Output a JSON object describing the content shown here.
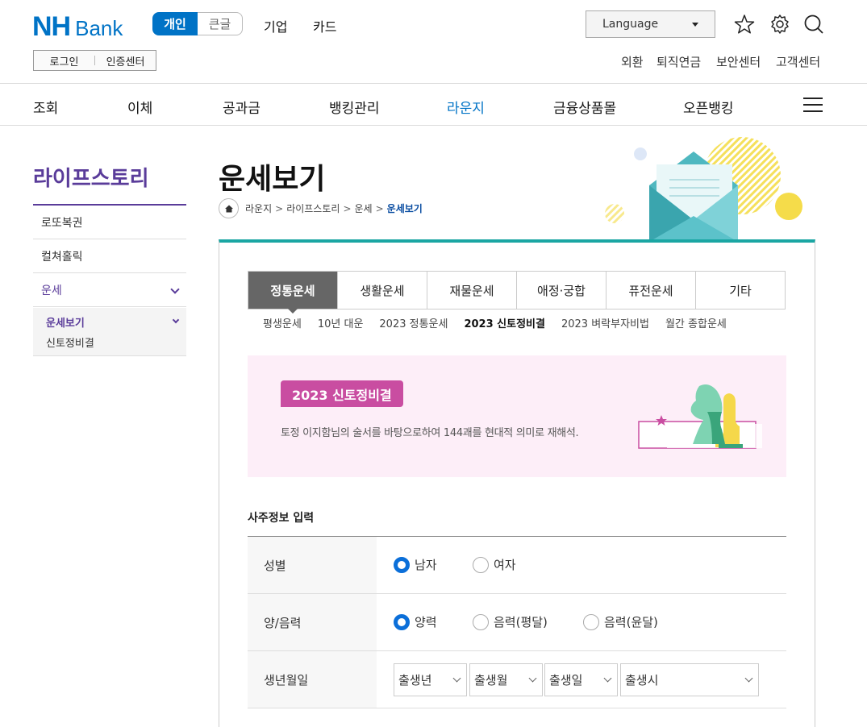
{
  "header": {
    "logo_nh": "NH",
    "logo_bank": "Bank",
    "segment": [
      "개인",
      "큰글"
    ],
    "top_links": [
      "기업",
      "카드"
    ],
    "login": "로그인",
    "cert": "인증센터",
    "language": "Language",
    "util_links": [
      "외환",
      "퇴직연금",
      "보안센터",
      "고객센터"
    ]
  },
  "gnb": [
    "조회",
    "이체",
    "공과금",
    "뱅킹관리",
    "라운지",
    "금융상품몰",
    "오픈뱅킹"
  ],
  "lnb": {
    "title": "라이프스토리",
    "items": [
      "로또복권",
      "컬쳐홀릭",
      "운세"
    ],
    "sub": [
      "운세보기",
      "신토정비결"
    ]
  },
  "page": {
    "title": "운세보기",
    "breadcrumb": [
      "라운지",
      "라이프스토리",
      "운세",
      "운세보기"
    ]
  },
  "tabs": [
    "정통운세",
    "생활운세",
    "재물운세",
    "애정·궁합",
    "퓨전운세",
    "기타"
  ],
  "subtabs": [
    "평생운세",
    "10년 대운",
    "2023 정통운세",
    "2023 신토정비결",
    "2023 벼락부자비법",
    "월간 종합운세"
  ],
  "banner": {
    "badge": "2023 신토정비결",
    "desc": "토정 이지함님의 술서를 바탕으로하여 144괘를 현대적 의미로 재해석."
  },
  "form": {
    "title": "사주정보 입력",
    "rows": [
      {
        "label": "성별",
        "options": [
          "남자",
          "여자"
        ]
      },
      {
        "label": "양/음력",
        "options": [
          "양력",
          "음력(평달)",
          "음력(윤달)"
        ]
      },
      {
        "label": "생년월일",
        "selects": [
          "출생년",
          "출생월",
          "출생일",
          "출생시"
        ]
      }
    ]
  },
  "colors": {
    "brand": "#0073c6",
    "lounge_purple": "#5a3c9a",
    "accent_teal": "#1aa6a3",
    "badge_pink": "#c94da1"
  }
}
